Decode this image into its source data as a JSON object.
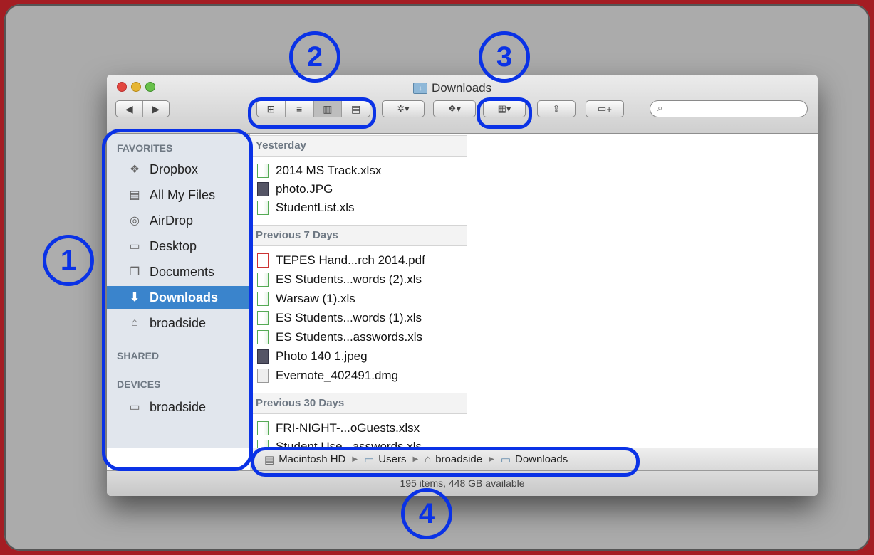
{
  "window": {
    "title": "Downloads"
  },
  "toolbar": {
    "nav": [
      "◀",
      "▶"
    ],
    "view_modes": [
      "icon-view",
      "list-view",
      "column-view",
      "coverflow-view"
    ],
    "action_label": "✲▾",
    "dropbox_label": "▾",
    "arrange_label": "▾",
    "share_label": "⇪",
    "newfolder_label": "+",
    "search_placeholder": ""
  },
  "sidebar": {
    "favorites_heading": "FAVORITES",
    "favorites": [
      {
        "label": "Dropbox",
        "icon": "dropbox-icon"
      },
      {
        "label": "All My Files",
        "icon": "all-files-icon"
      },
      {
        "label": "AirDrop",
        "icon": "airdrop-icon"
      },
      {
        "label": "Desktop",
        "icon": "desktop-icon"
      },
      {
        "label": "Documents",
        "icon": "documents-icon"
      },
      {
        "label": "Downloads",
        "icon": "downloads-icon"
      },
      {
        "label": "broadside",
        "icon": "home-icon"
      }
    ],
    "shared_heading": "SHARED",
    "devices_heading": "DEVICES",
    "devices": [
      {
        "label": "broadside",
        "icon": "laptop-icon"
      }
    ]
  },
  "groups": [
    {
      "heading": "Yesterday",
      "files": [
        {
          "name": "2014 MS Track.xlsx",
          "type": "xls"
        },
        {
          "name": "photo.JPG",
          "type": "img"
        },
        {
          "name": "StudentList.xls",
          "type": "xls"
        }
      ]
    },
    {
      "heading": "Previous 7 Days",
      "files": [
        {
          "name": "TEPES Hand...rch 2014.pdf",
          "type": "pdf"
        },
        {
          "name": "ES Students...words (2).xls",
          "type": "xls"
        },
        {
          "name": "Warsaw (1).xls",
          "type": "xls"
        },
        {
          "name": "ES Students...words (1).xls",
          "type": "xls"
        },
        {
          "name": "ES Students...asswords.xls",
          "type": "xls"
        },
        {
          "name": "Photo 140 1.jpeg",
          "type": "img"
        },
        {
          "name": "Evernote_402491.dmg",
          "type": "dmg"
        }
      ]
    },
    {
      "heading": "Previous 30 Days",
      "files": [
        {
          "name": "FRI-NIGHT-...oGuests.xlsx",
          "type": "xls"
        },
        {
          "name": "Student Use...asswords.xls",
          "type": "xls"
        }
      ]
    }
  ],
  "pathbar": [
    "Macintosh HD",
    "Users",
    "broadside",
    "Downloads"
  ],
  "status": "195 items, 448 GB available",
  "annotations": [
    "1",
    "2",
    "3",
    "4"
  ],
  "colors": {
    "highlight": "#0a32e6",
    "background": "#a41d23",
    "sidebar_selected": "#3a84cc"
  }
}
